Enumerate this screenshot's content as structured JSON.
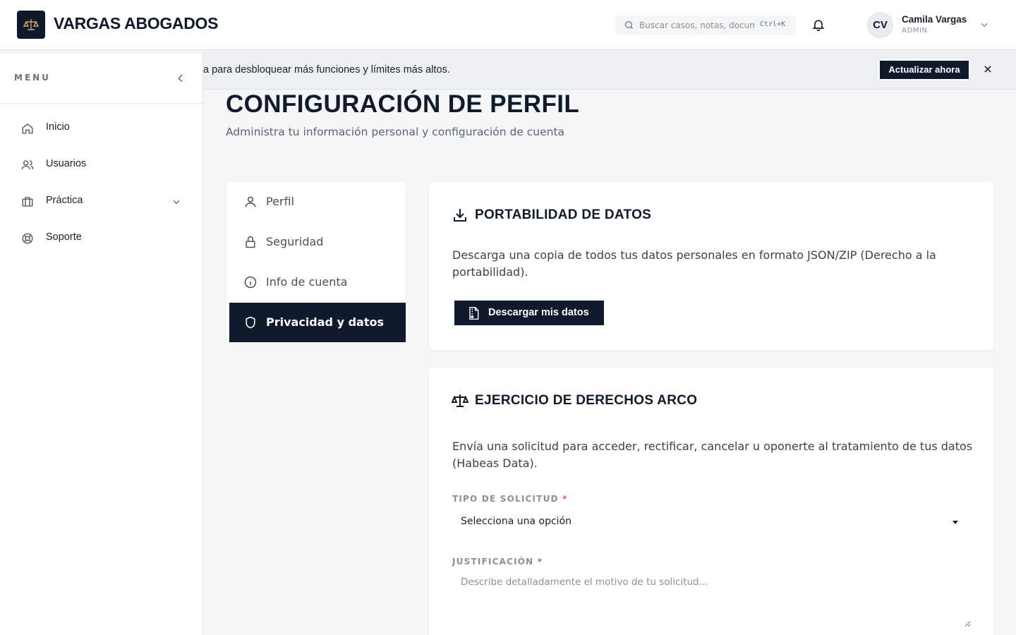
{
  "brand": {
    "name": "VARGAS ABOGADOS",
    "logo_icon": "scales-of-justice-icon"
  },
  "header": {
    "search_placeholder": "Buscar casos, notas, documentos...",
    "search_shortcut": "Ctrl+K",
    "user": {
      "initials": "CV",
      "name": "Camila Vargas",
      "role": "ADMIN"
    }
  },
  "sidebar": {
    "menu_label": "MENU",
    "items": [
      {
        "label": "Inicio",
        "icon": "home-icon"
      },
      {
        "label": "Usuarios",
        "icon": "users-icon"
      },
      {
        "label": "Práctica",
        "icon": "briefcase-icon",
        "expandable": true
      },
      {
        "label": "Soporte",
        "icon": "lifebuoy-icon"
      }
    ]
  },
  "banner": {
    "text": "a para desbloquear más funciones y límites más altos.",
    "button_label": "Actualizar ahora"
  },
  "page": {
    "title": "CONFIGURACIÓN DE PERFIL",
    "subtitle": "Administra tu información personal y configuración de cuenta"
  },
  "tabs": [
    {
      "label": "Perfil",
      "icon": "user-icon",
      "active": false
    },
    {
      "label": "Seguridad",
      "icon": "lock-icon",
      "active": false
    },
    {
      "label": "Info de cuenta",
      "icon": "info-icon",
      "active": false
    },
    {
      "label": "Privacidad y datos",
      "icon": "shield-icon",
      "active": true
    }
  ],
  "portability": {
    "title": "PORTABILIDAD DE DATOS",
    "description": "Descarga una copia de todos tus datos personales en formato JSON/ZIP (Derecho a la portabilidad).",
    "button_label": "Descargar mis datos"
  },
  "arco": {
    "title": "EJERCICIO DE DERECHOS ARCO",
    "description": "Envía una solicitud para acceder, rectificar, cancelar u oponerte al tratamiento de tus datos (Habeas Data).",
    "type_label": "TIPO DE SOLICITUD",
    "type_value": "Selecciona una opción",
    "justification_label": "JUSTIFICACIÓN",
    "justification_placeholder": "Describe detalladamente el motivo de tu solicitud...",
    "required_mark": "*"
  },
  "colors": {
    "primary": "#0f1a2c",
    "required": "#e05555",
    "banner_bg": "#edeff2"
  }
}
